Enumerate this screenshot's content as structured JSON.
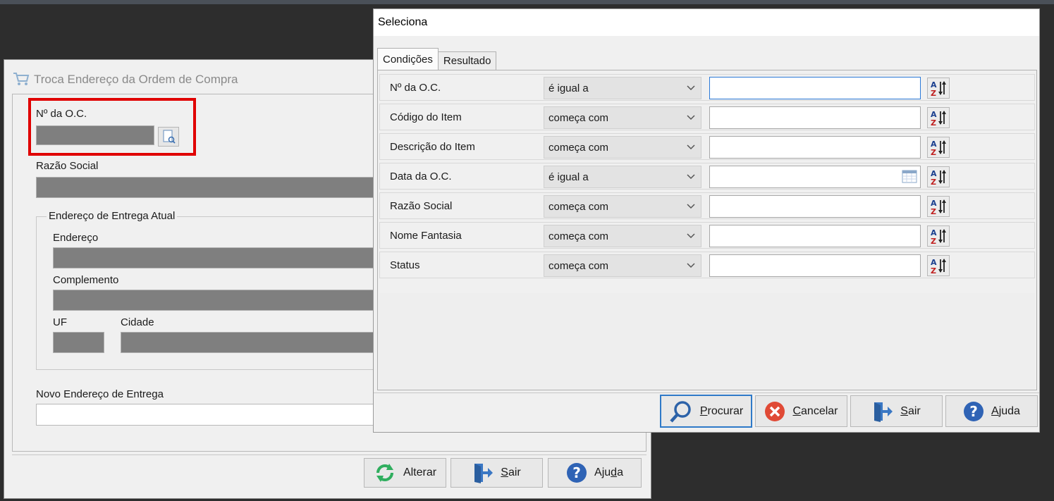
{
  "background_window": {
    "title": "Troca Endereço da Ordem de Compra",
    "oc_label": "Nº da O.C.",
    "razao_social_label": "Razão Social",
    "group_title": "Endereço de Entrega Atual",
    "endereco_label": "Endereço",
    "complemento_label": "Complemento",
    "uf_label": "UF",
    "cidade_label": "Cidade",
    "novo_endereco_label": "Novo Endereço de Entrega",
    "buttons": {
      "alterar": "Alterar",
      "sair_first": "S",
      "sair_rest": "air",
      "ajuda_first": "Aju",
      "ajuda_u": "d",
      "ajuda_rest": "a"
    }
  },
  "dialog": {
    "title": "Seleciona",
    "tabs": [
      "Condições",
      "Resultado"
    ],
    "conditions": [
      {
        "label": "Nº da O.C.",
        "operator": "é igual a",
        "value": ""
      },
      {
        "label": "Código do Item",
        "operator": "começa com",
        "value": ""
      },
      {
        "label": "Descrição do Item",
        "operator": "começa com",
        "value": ""
      },
      {
        "label": "Data da O.C.",
        "operator": "é igual a",
        "value": ""
      },
      {
        "label": "Razão Social",
        "operator": "começa com",
        "value": ""
      },
      {
        "label": "Nome Fantasia",
        "operator": "começa com",
        "value": ""
      },
      {
        "label": "Status",
        "operator": "começa com",
        "value": ""
      }
    ],
    "buttons": {
      "procurar_first": "P",
      "procurar_rest": "rocurar",
      "cancelar_first": "C",
      "cancelar_rest": "ancelar",
      "sair_first": "S",
      "sair_rest": "air",
      "ajuda_first": "A",
      "ajuda_rest": "juda"
    }
  },
  "colors": {
    "highlight_box": "#e00000",
    "focus_border": "#2e79c8",
    "disabled_field": "#7f7f7f"
  }
}
